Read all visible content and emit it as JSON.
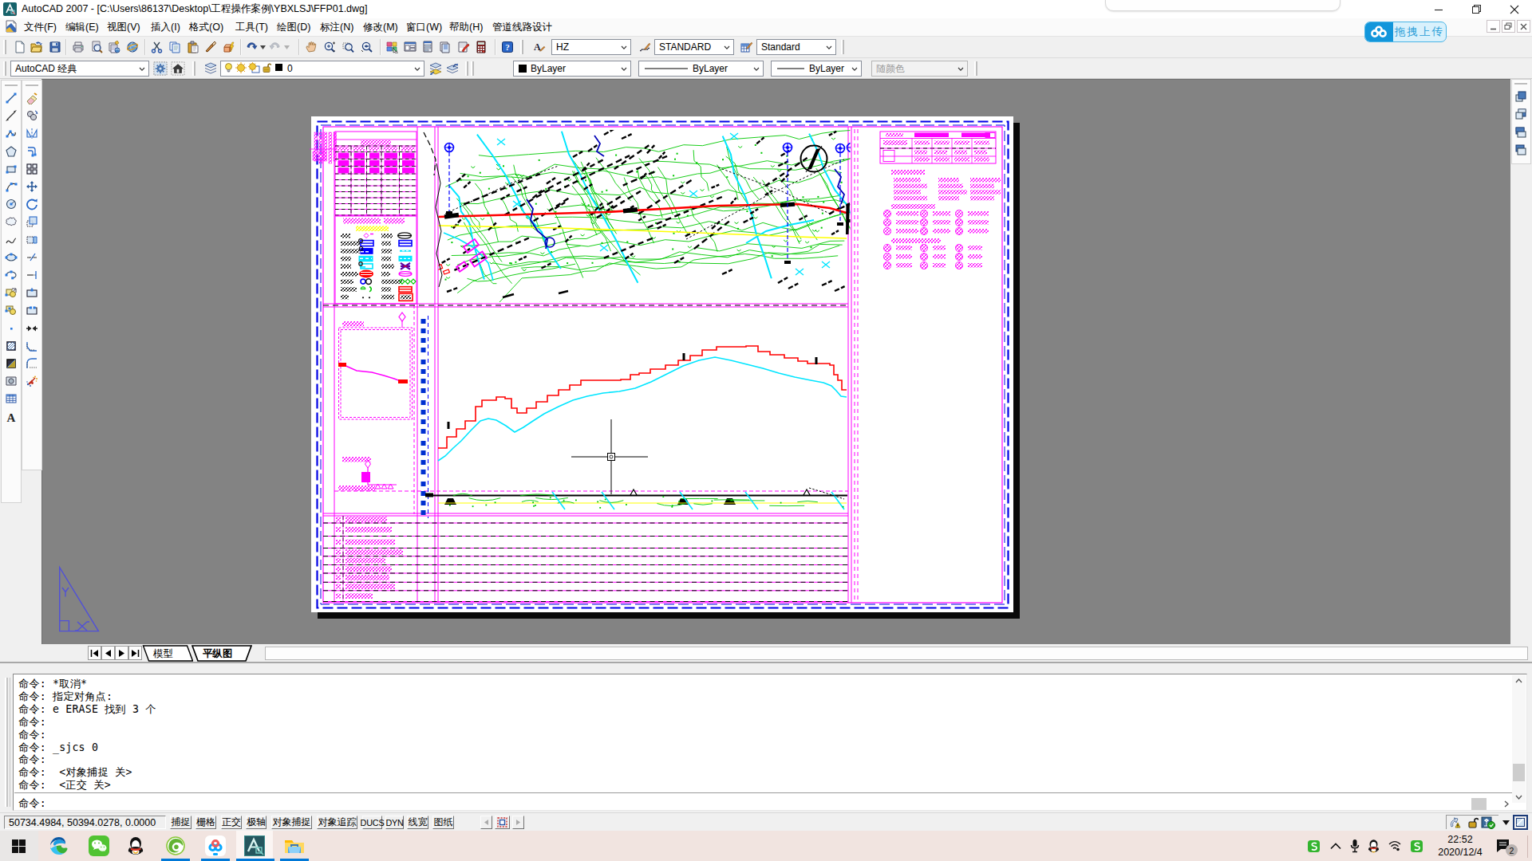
{
  "window": {
    "title": "AutoCAD 2007 - [C:\\Users\\86137\\Desktop\\工程操作案例\\YBXLSJ\\FFP01.dwg]"
  },
  "menu": {
    "items": [
      "文件(F)",
      "编辑(E)",
      "视图(V)",
      "插入(I)",
      "格式(O)",
      "工具(T)",
      "绘图(D)",
      "标注(N)",
      "修改(M)",
      "窗口(W)",
      "帮助(H)",
      "管道线路设计"
    ]
  },
  "toolbars": {
    "standard_icons": [
      "new",
      "open",
      "save",
      "plot",
      "plot-preview",
      "publish",
      "3d-dwf",
      "cut",
      "copy",
      "paste",
      "match-properties",
      "block-editor",
      "undo",
      "redo",
      "pan-realtime",
      "zoom-realtime",
      "zoom-window",
      "zoom-previous",
      "properties",
      "designcenter",
      "tool-palettes",
      "sheet-set-manager",
      "markup-set-manager",
      "quickcalc",
      "help"
    ],
    "styles": {
      "text_style": "HZ",
      "dim_style": "STANDARD",
      "table_style": "Standard"
    },
    "workspace": {
      "value": "AutoCAD 经典",
      "icons": [
        "workspace-settings-gear",
        "my-workspace-home"
      ]
    },
    "layers": {
      "icon": "layer-manager",
      "current_layer": "0",
      "state_icons": [
        "bulb-on",
        "sun-on",
        "sun-viewport",
        "lock-open",
        "color-swatch"
      ],
      "buttons": [
        "make-object-layer-current",
        "layer-previous"
      ]
    },
    "properties": {
      "color": "ByLayer",
      "linetype": "ByLayer",
      "lineweight": "ByLayer",
      "plot_style": "随颜色"
    }
  },
  "draw_toolbar": [
    "line",
    "construction-line",
    "polyline",
    "polygon",
    "rectangle",
    "arc",
    "circle",
    "revision-cloud",
    "spline",
    "ellipse",
    "ellipse-arc",
    "insert-block",
    "make-block",
    "point",
    "hatch",
    "gradient",
    "region",
    "table",
    "multiline-text"
  ],
  "modify_toolbar": [
    "erase",
    "copy",
    "mirror",
    "offset",
    "array",
    "move",
    "rotate",
    "scale",
    "stretch",
    "trim",
    "extend",
    "break-at-point",
    "break",
    "join",
    "chamfer",
    "fillet",
    "explode"
  ],
  "draworder_toolbar": [
    "bring-to-front",
    "send-to-back",
    "bring-above-objects",
    "send-under-objects"
  ],
  "tabs": {
    "items": [
      {
        "label": "模型",
        "active": false
      },
      {
        "label": "平纵图",
        "active": true
      }
    ],
    "nav": [
      "first-tab",
      "previous-tab",
      "next-tab",
      "last-tab"
    ]
  },
  "command": {
    "history": [
      "命令: *取消*",
      "命令: 指定对角点:",
      "命令: e ERASE 找到 3 个",
      "命令:",
      "命令:",
      "命令: _sjcs 0",
      "命令:",
      "命令:  <对象捕捉 关>",
      "命令:  <正交 关>"
    ],
    "prompt": "命令:"
  },
  "statusbar": {
    "coordinates": "50734.4984, 50394.0278, 0.0000",
    "buttons": [
      "捕捉",
      "栅格",
      "正交",
      "极轴",
      "对象捕捉",
      "对象追踪",
      "DUCS",
      "DYN",
      "线宽",
      "图纸"
    ],
    "tray_icons": [
      "communication-warning",
      "toolbar-lock",
      "associated-standards-ok",
      "tray-menu-arrow",
      "clean-screen"
    ]
  },
  "overlay": {
    "netdisk_upload_label": "拖拽上传"
  },
  "taskbar": {
    "apps": [
      "start",
      "edge",
      "wechat",
      "qq",
      "browser-360",
      "baidu-netdisk",
      "autocad-2007",
      "file-explorer"
    ],
    "running_apps": [
      "browser-360",
      "baidu-netdisk",
      "autocad-2007",
      "file-explorer"
    ],
    "active_app": "autocad-2007",
    "tray": [
      "sogou-input",
      "hidden-icons",
      "microphone",
      "qq-tray",
      "network",
      "sogou-tool"
    ],
    "clock": {
      "time": "22:52",
      "date": "2020/12/4"
    },
    "notification_badge": "2"
  },
  "colors": {
    "accent_blue": "#0078d7",
    "cad_magenta": "#FF00FF",
    "cad_red": "#FF0000",
    "cad_green": "#00C800",
    "cad_cyan": "#00E5FF",
    "cad_yellow": "#FFFF00",
    "canvas_gray": "#838383",
    "taskbar_pink": "#f2e5e1"
  }
}
